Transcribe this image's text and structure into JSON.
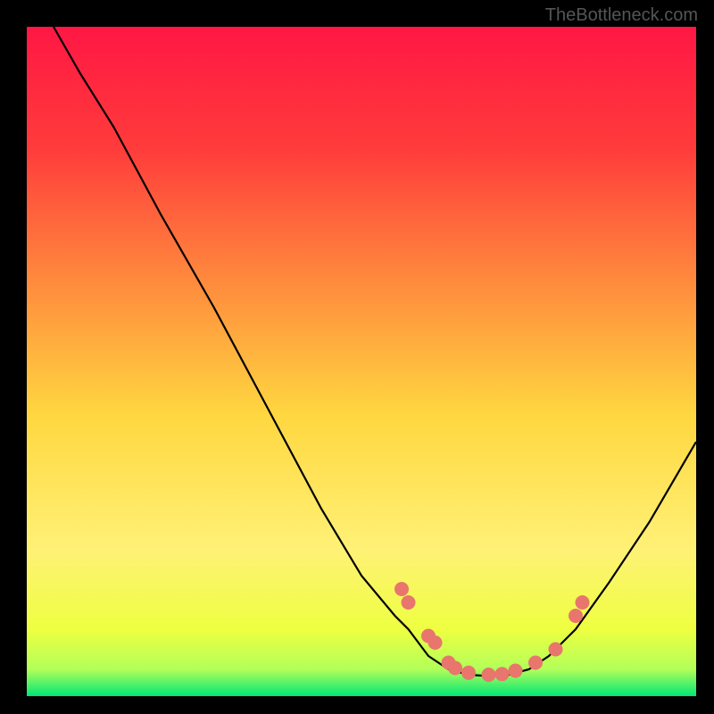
{
  "watermark": "TheBottleneck.com",
  "chart_data": {
    "type": "line",
    "title": "",
    "xlabel": "",
    "ylabel": "",
    "xlim": [
      0,
      100
    ],
    "ylim": [
      0,
      100
    ],
    "background_gradient": {
      "type": "vertical",
      "stops": [
        {
          "offset": 0,
          "color": "#ff1744"
        },
        {
          "offset": 0.18,
          "color": "#ff3b3b"
        },
        {
          "offset": 0.38,
          "color": "#ff8a3d"
        },
        {
          "offset": 0.58,
          "color": "#ffd740"
        },
        {
          "offset": 0.78,
          "color": "#fff176"
        },
        {
          "offset": 0.9,
          "color": "#eeff41"
        },
        {
          "offset": 0.96,
          "color": "#b2ff59"
        },
        {
          "offset": 1.0,
          "color": "#00e676"
        }
      ]
    },
    "series": [
      {
        "name": "curve",
        "type": "line",
        "color": "#000000",
        "points": [
          {
            "x": 4,
            "y": 100
          },
          {
            "x": 8,
            "y": 93
          },
          {
            "x": 13,
            "y": 85
          },
          {
            "x": 20,
            "y": 72
          },
          {
            "x": 28,
            "y": 58
          },
          {
            "x": 36,
            "y": 43
          },
          {
            "x": 44,
            "y": 28
          },
          {
            "x": 50,
            "y": 18
          },
          {
            "x": 55,
            "y": 12
          },
          {
            "x": 57,
            "y": 10
          },
          {
            "x": 60,
            "y": 6
          },
          {
            "x": 63,
            "y": 4
          },
          {
            "x": 66,
            "y": 3.2
          },
          {
            "x": 69,
            "y": 3
          },
          {
            "x": 72,
            "y": 3.2
          },
          {
            "x": 75,
            "y": 4
          },
          {
            "x": 78,
            "y": 6
          },
          {
            "x": 82,
            "y": 10
          },
          {
            "x": 87,
            "y": 17
          },
          {
            "x": 93,
            "y": 26
          },
          {
            "x": 100,
            "y": 38
          }
        ]
      },
      {
        "name": "markers",
        "type": "scatter",
        "color": "#e8766d",
        "points": [
          {
            "x": 56,
            "y": 16
          },
          {
            "x": 57,
            "y": 14
          },
          {
            "x": 60,
            "y": 9
          },
          {
            "x": 61,
            "y": 8
          },
          {
            "x": 63,
            "y": 5
          },
          {
            "x": 64,
            "y": 4.2
          },
          {
            "x": 66,
            "y": 3.5
          },
          {
            "x": 69,
            "y": 3.2
          },
          {
            "x": 71,
            "y": 3.3
          },
          {
            "x": 73,
            "y": 3.8
          },
          {
            "x": 76,
            "y": 5
          },
          {
            "x": 79,
            "y": 7
          },
          {
            "x": 82,
            "y": 12
          },
          {
            "x": 83,
            "y": 14
          }
        ]
      }
    ]
  }
}
